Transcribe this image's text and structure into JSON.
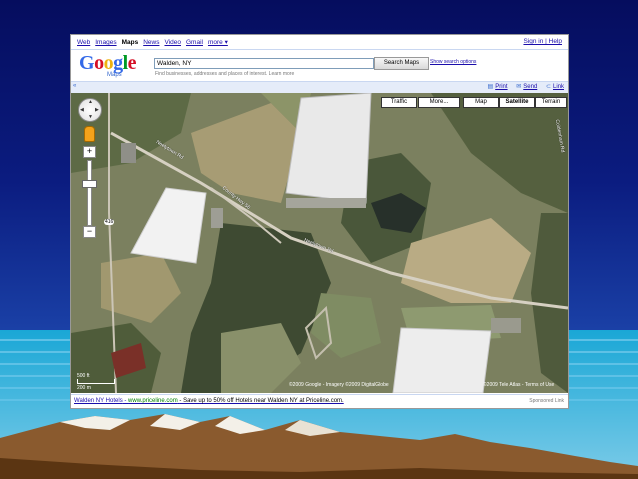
{
  "topnav": {
    "links": [
      "Web",
      "Images",
      "Maps",
      "News",
      "Video",
      "Gmail",
      "more ▾"
    ],
    "active": "Maps",
    "account": "Sign in | Help"
  },
  "logo": {
    "text": "Google",
    "sub": "Maps"
  },
  "search": {
    "value": "Walden, NY",
    "button": "Search Maps",
    "options": "Show search options",
    "hint": "Find businesses, addresses and places of interest. Learn more"
  },
  "toolbar": {
    "collapse": "«",
    "print": "Print",
    "send": "Send",
    "link": "Link"
  },
  "map": {
    "buttons": [
      "Traffic",
      "More...",
      "Map",
      "Satellite",
      "Terrain"
    ],
    "selected": "Satellite",
    "scale_top": "500 ft",
    "scale_bottom": "200 m",
    "copyright": "©2009 Google - Imagery ©2009 DigitalGlobe",
    "copyright2": "©2009 Tele Atlas - Terms of Use",
    "roads": [
      "Neelytown Rd",
      "County Hwy 56",
      "Neelytown Rd",
      "Coldenham Rd"
    ],
    "route_shield": "416"
  },
  "ad": {
    "link": "Walden NY Hotels",
    "url": "www.priceline.com",
    "text": "- Save up to 50% off Hotels near Walden NY at Priceline.com.",
    "sponsored": "Sponsored Link"
  },
  "colors": {
    "accent": "#3366cc",
    "link": "#1a0dab",
    "background": "#0b1c80",
    "sea": "#14a3d4"
  }
}
